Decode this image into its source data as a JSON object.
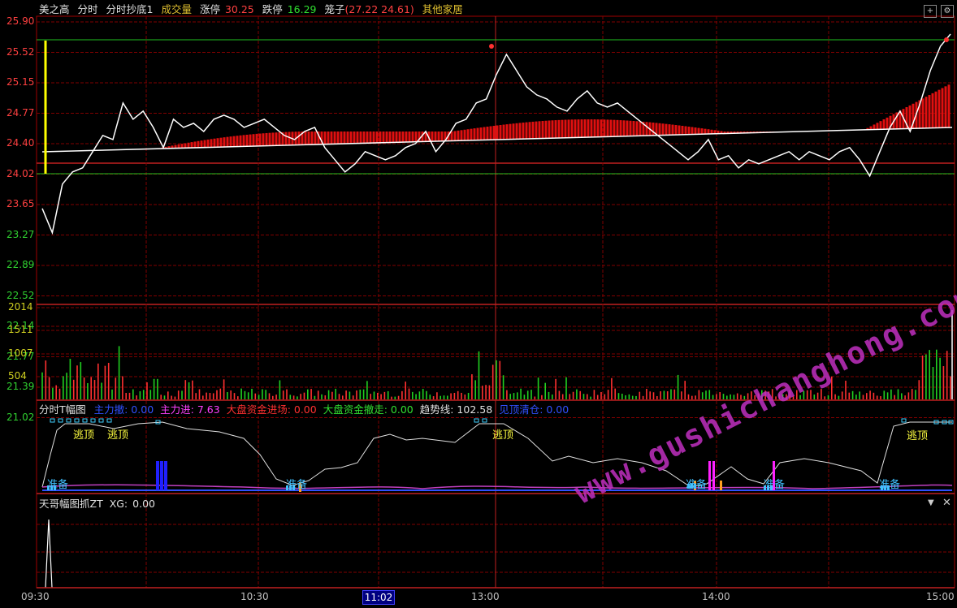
{
  "header_price": {
    "stock_name": "美之高",
    "tabs": [
      "分时",
      "分时抄底1"
    ],
    "volume_label": "成交量",
    "limit_up_label": "涨停",
    "limit_up_value": "30.25",
    "limit_down_label": "跌停",
    "limit_down_value": "16.29",
    "cage_label": "笼子",
    "cage_values": "(27.22 24.61)",
    "industry": "其他家居"
  },
  "price_axis": [
    "25.90",
    "25.52",
    "25.15",
    "24.77",
    "24.40",
    "24.02",
    "23.65",
    "23.27",
    "22.89",
    "22.52",
    "22.14",
    "21.77",
    "21.39",
    "21.02"
  ],
  "volume_axis": [
    "2014",
    "1511",
    "1007",
    "504"
  ],
  "indicator_header": {
    "title": "分时T幅图",
    "items": [
      {
        "label": "主力撤:",
        "value": "0.00",
        "color": "#3050ff"
      },
      {
        "label": "主力进:",
        "value": "7.63",
        "color": "#ff40ff"
      },
      {
        "label": "大盘资金进场:",
        "value": "0.00",
        "color": "#ff3030"
      },
      {
        "label": "大盘资金撤走:",
        "value": "0.00",
        "color": "#30e030"
      },
      {
        "label": "趋势线:",
        "value": "102.58",
        "color": "#e0e0e0"
      },
      {
        "label": "见顶清仓:",
        "value": "0.00",
        "color": "#3050ff"
      }
    ]
  },
  "indicator_labels": {
    "escape_top": "逃顶",
    "prepare": "准备"
  },
  "bottom_header": {
    "title": "天哥幅图抓ZT",
    "xg_label": "XG:",
    "xg_value": "0.00"
  },
  "time_axis": [
    "09:30",
    "10:30",
    "13:00",
    "14:00",
    "15:00"
  ],
  "cursor_time": "11:02",
  "watermark": "www.gushichanghong.com",
  "colors": {
    "up": "#ff3030",
    "down": "#20d020",
    "price_line": "#ffffff",
    "avg_bar": "#e01010",
    "grid": "#800000",
    "axis_up": "#ff4040",
    "axis_down": "#30d030",
    "volume_axis": "#d0d020"
  },
  "chart_data": [
    {
      "type": "line",
      "y_ticks": [
        "25.90",
        "25.52",
        "25.15",
        "24.77",
        "24.40",
        "24.02",
        "23.65",
        "23.27",
        "22.89",
        "22.52",
        "22.14",
        "21.77",
        "21.39",
        "21.02"
      ],
      "ylim": [
        21.02,
        25.9
      ],
      "x_ticks": [
        "09:30",
        "10:30",
        "13:00",
        "14:00",
        "15:00"
      ],
      "series": [
        {
          "values": [
            23.6,
            23.3,
            23.9,
            24.05,
            24.1,
            24.3,
            24.5,
            24.45,
            24.9,
            24.7,
            24.8,
            24.6,
            24.35,
            24.7,
            24.6,
            24.65,
            24.55,
            24.7,
            24.75,
            24.7,
            24.6,
            24.65,
            24.7,
            24.6,
            24.5,
            24.45,
            24.55,
            24.6,
            24.35,
            24.2,
            24.05,
            24.15,
            24.3,
            24.25,
            24.2,
            24.25,
            24.35,
            24.4,
            24.55,
            24.3,
            24.45,
            24.65,
            24.7,
            24.9,
            24.95,
            25.25,
            25.5,
            25.3,
            25.1,
            25.0,
            24.95,
            24.85,
            24.8,
            24.95,
            25.05,
            24.9,
            24.85,
            24.9,
            24.8,
            24.7,
            24.6,
            24.5,
            24.4,
            24.3,
            24.2,
            24.3,
            24.45,
            24.2,
            24.25,
            24.1,
            24.2,
            24.15,
            24.2,
            24.25,
            24.3,
            24.2,
            24.3,
            24.25,
            24.2,
            24.3,
            24.35,
            24.2,
            24.0,
            24.3,
            24.6,
            24.8,
            24.55,
            24.9,
            25.3,
            25.6,
            25.75
          ]
        }
      ]
    },
    {
      "type": "bar",
      "y_ticks": [
        "2014",
        "1511",
        "1007",
        "504"
      ],
      "ylim": [
        0,
        2014
      ]
    }
  ]
}
